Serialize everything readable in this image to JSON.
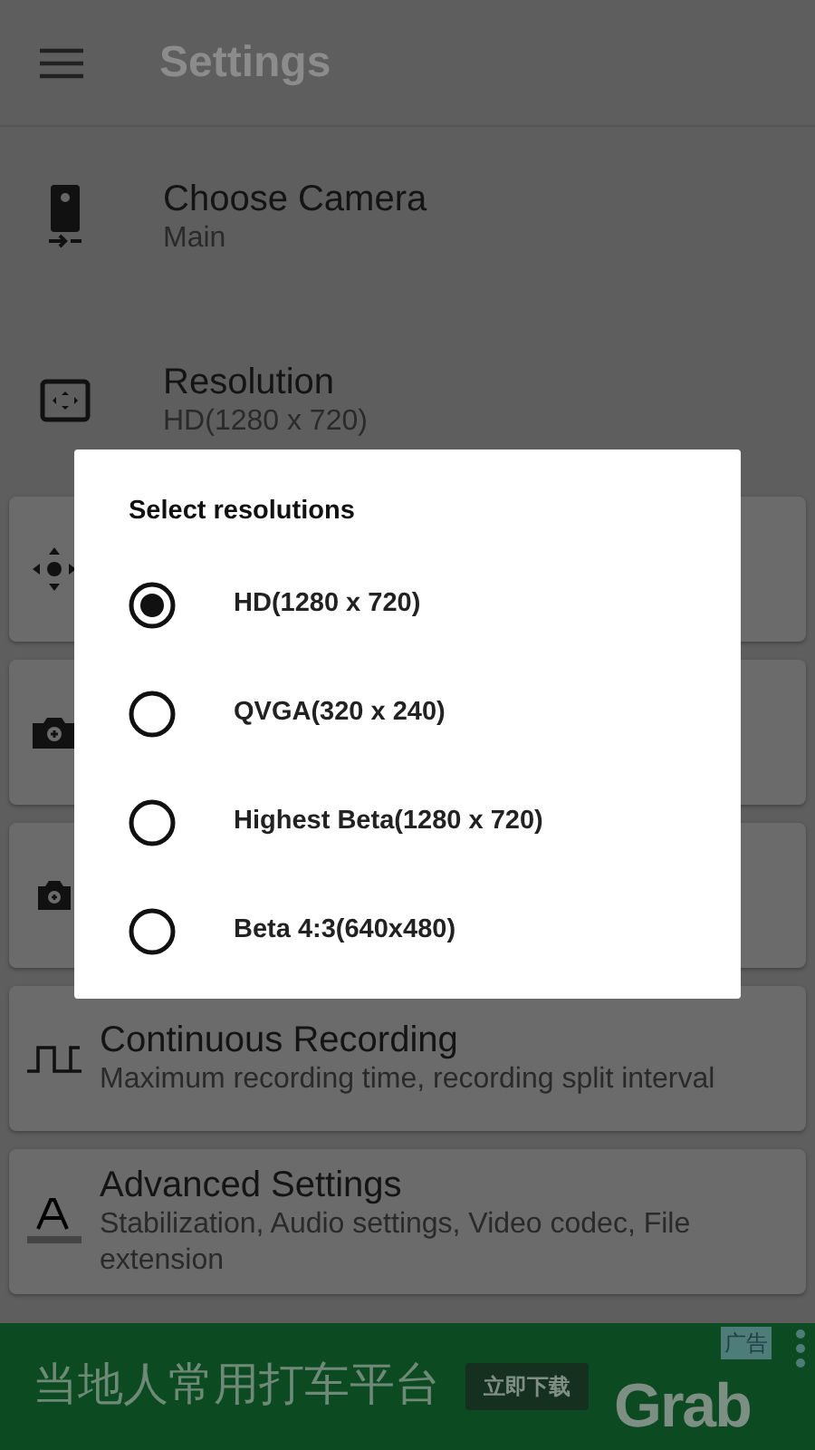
{
  "toolbar": {
    "title": "Settings"
  },
  "settings": [
    {
      "kind": "row",
      "title": "Choose Camera",
      "subtitle": "Main"
    },
    {
      "kind": "row",
      "title": "Resolution",
      "subtitle": "HD(1280 x 720)"
    },
    {
      "kind": "card"
    },
    {
      "kind": "card"
    },
    {
      "kind": "card"
    },
    {
      "kind": "card",
      "title": "Continuous Recording",
      "subtitle": "Maximum recording time, recording split interval"
    },
    {
      "kind": "card",
      "title": "Advanced Settings",
      "subtitle": "Stabilization, Audio settings, Video codec, File extension"
    }
  ],
  "dialog": {
    "title": "Select resolutions",
    "options": [
      {
        "label": "HD(1280 x 720)",
        "selected": true
      },
      {
        "label": "QVGA(320 x 240)",
        "selected": false
      },
      {
        "label": "Highest Beta(1280 x 720)",
        "selected": false
      },
      {
        "label": "Beta 4:3(640x480)",
        "selected": false
      }
    ]
  },
  "ad": {
    "tag": "广告",
    "headline": "当地人常用打车平台",
    "button": "立即下载",
    "brand": "Grab"
  }
}
